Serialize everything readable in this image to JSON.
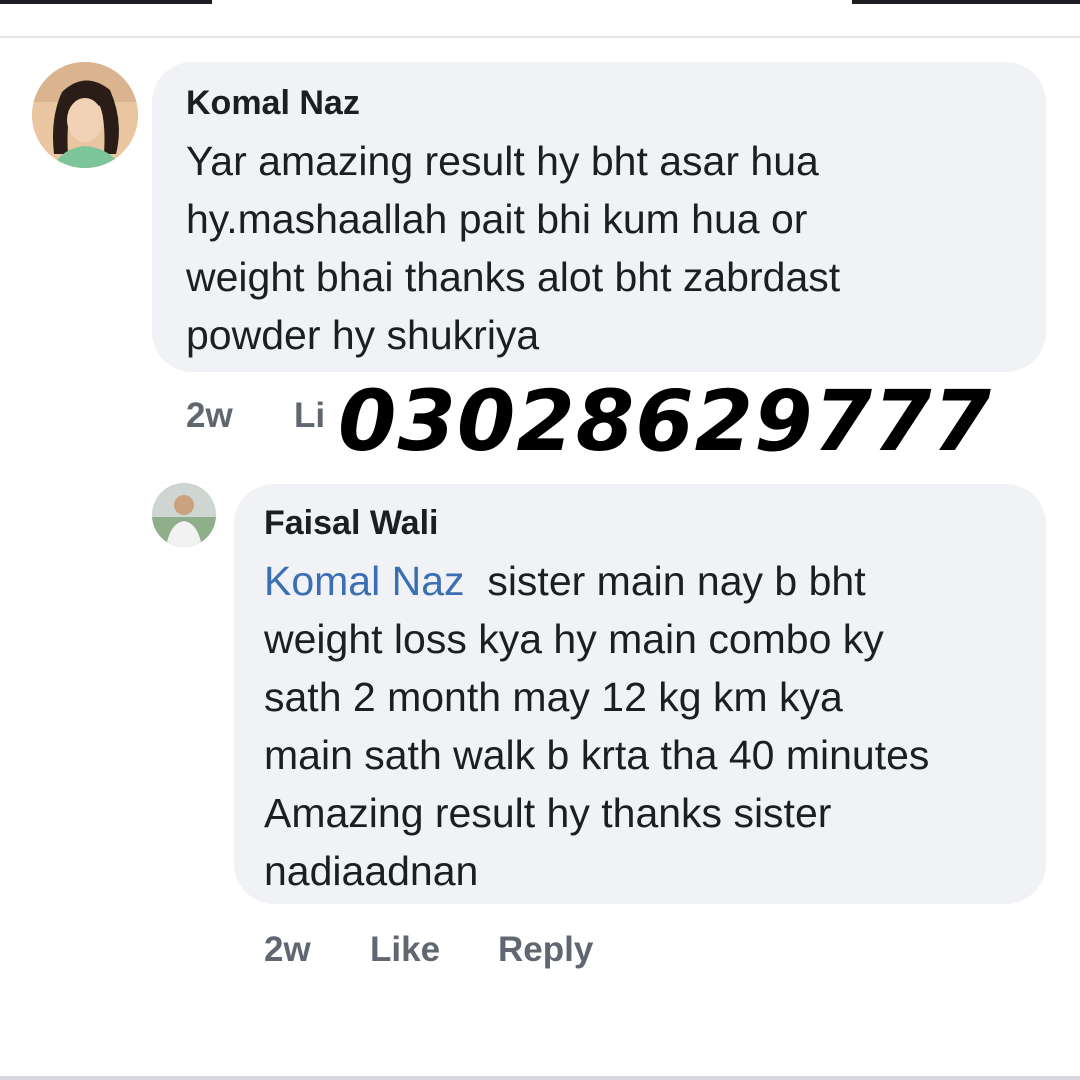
{
  "comments": [
    {
      "author": "Komal Naz",
      "text_lines": [
        "Yar amazing result hy bht asar hua",
        "hy.mashaallah  pait bhi kum hua or",
        "weight  bhai thanks alot bht  zabrdast",
        "powder  hy  shukriya"
      ],
      "time": "2w",
      "like_partial": "Li"
    },
    {
      "author": "Faisal Wali",
      "mention": "Komal Naz",
      "text_lines": [
        "sister  main nay b bht",
        "weight loss  kya hy main combo ky",
        "sath 2 month may 12 kg km kya",
        "main sath walk b krta tha 40 minutes",
        "Amazing result  hy  thanks sister",
        "nadiaadnan"
      ],
      "time": "2w",
      "like": "Like",
      "reply": "Reply"
    }
  ],
  "overlay_phone": "03028629777",
  "colors": {
    "bubble": "#f0f2f5",
    "mention": "#3b6fb4",
    "meta": "#606770",
    "text": "#1c1e21"
  }
}
